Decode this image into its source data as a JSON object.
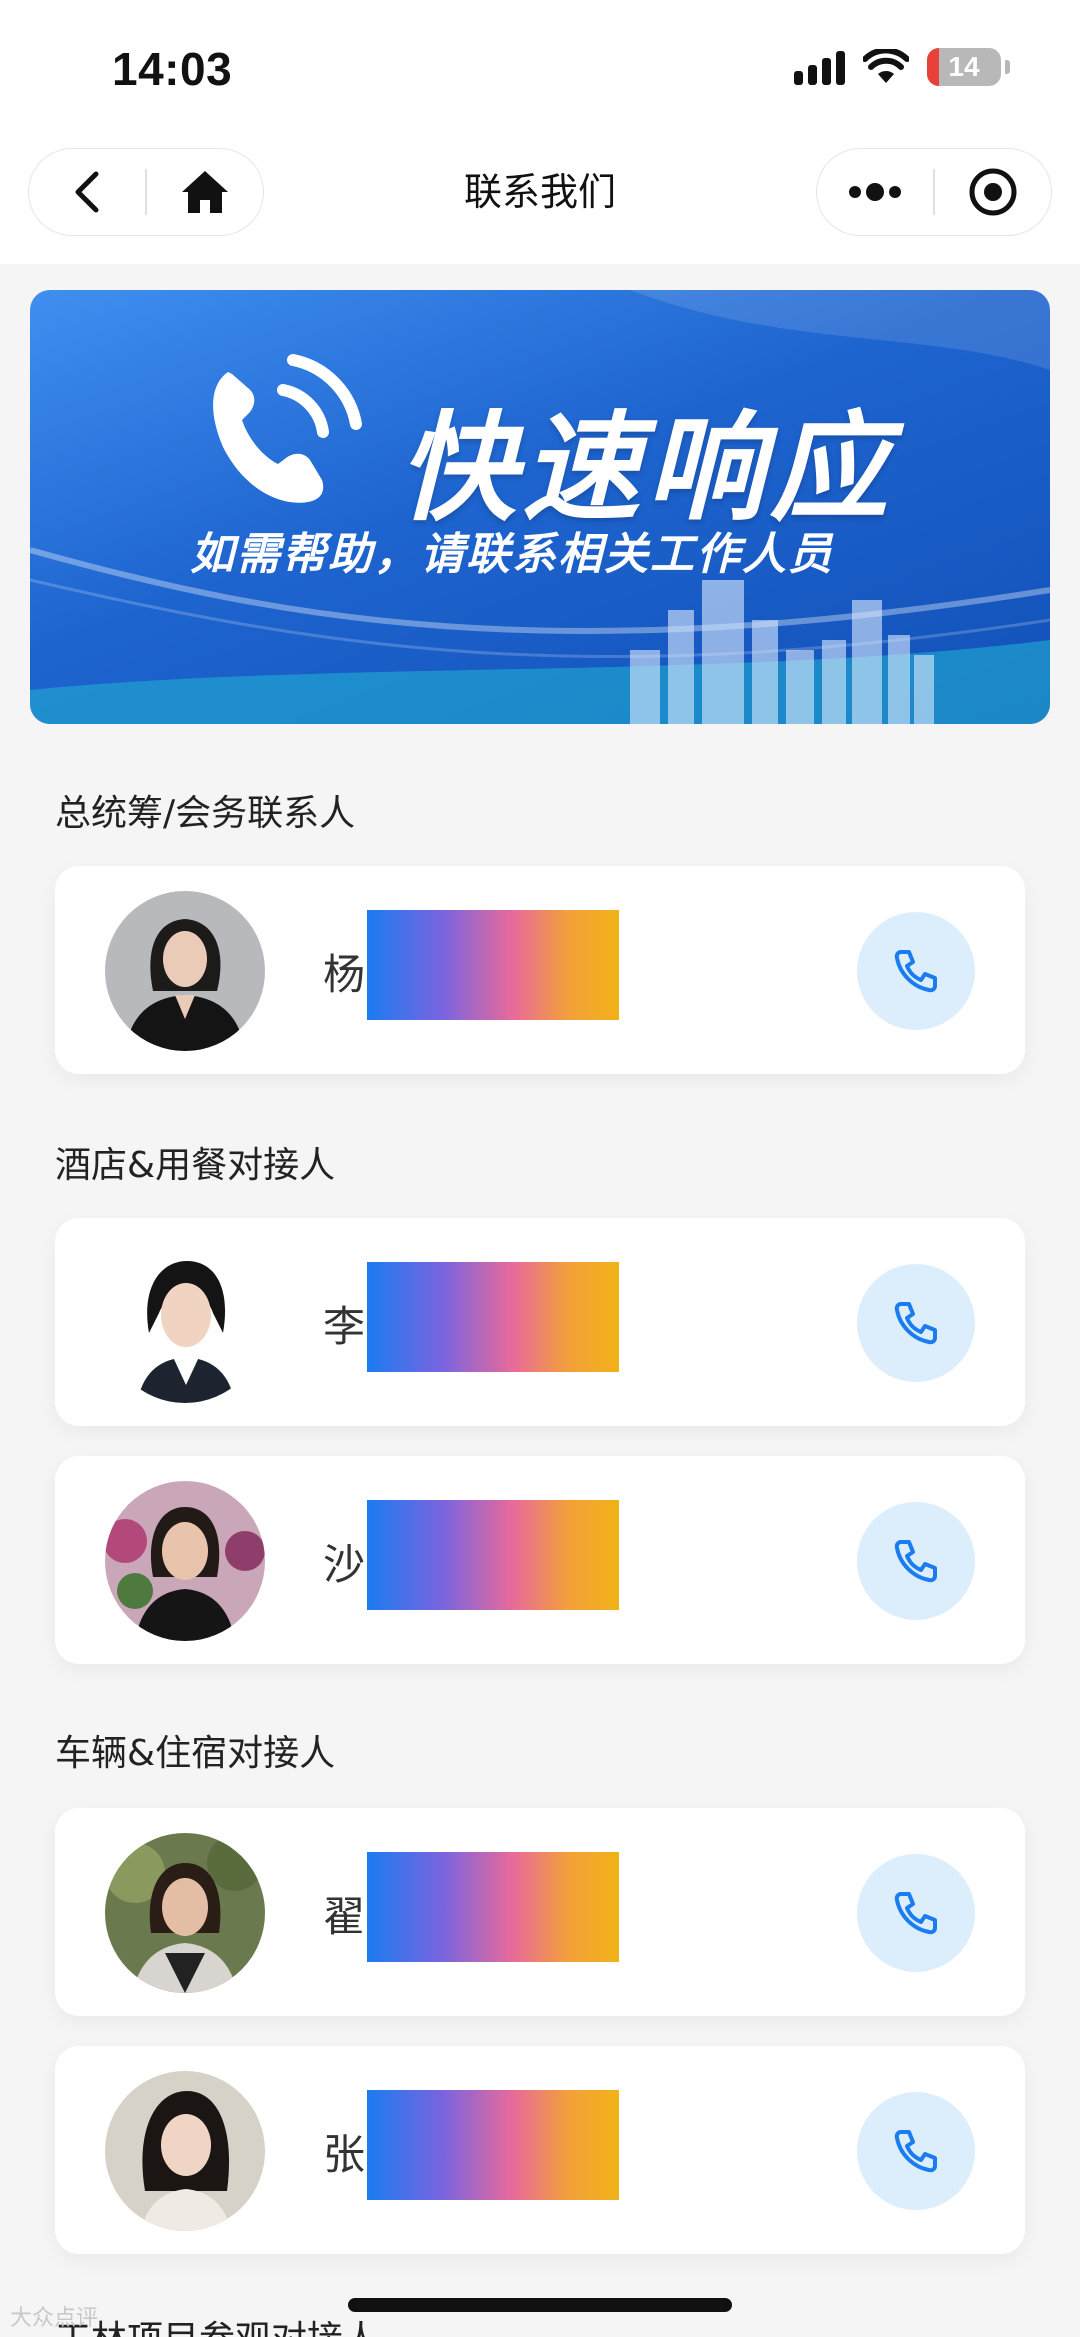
{
  "status_bar": {
    "time": "14:03",
    "battery": "14"
  },
  "nav": {
    "title": "联系我们"
  },
  "banner": {
    "title": "快速响应",
    "subtitle": "如需帮助，请联系相关工作人员"
  },
  "sections": [
    {
      "title": "总统筹/会务联系人",
      "contacts": [
        {
          "name": "杨"
        }
      ]
    },
    {
      "title": "酒店&用餐对接人",
      "contacts": [
        {
          "name": "李"
        },
        {
          "name": "沙"
        }
      ]
    },
    {
      "title": "车辆&住宿对接人",
      "contacts": [
        {
          "name": "翟"
        },
        {
          "name": "张"
        }
      ]
    },
    {
      "title": "工林项目参观对接人"
    }
  ],
  "watermark": "大众点评",
  "colors": {
    "accent": "#1a7cf0",
    "call_bg": "#dcedfc",
    "page_bg": "#f5f5f5"
  },
  "icons": [
    "back-icon",
    "home-icon",
    "more-icon",
    "target-icon",
    "phone-icon"
  ]
}
